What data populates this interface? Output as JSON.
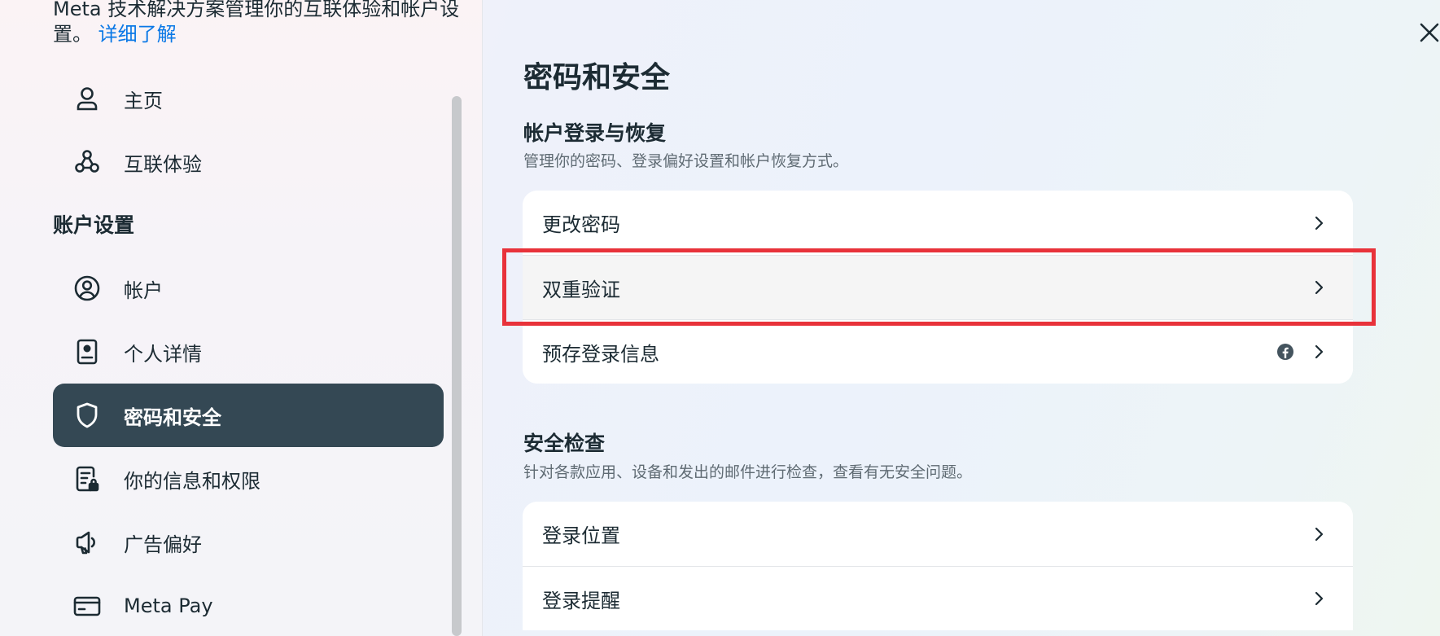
{
  "sidebar": {
    "intro_text": "Meta 技术解决方案管理你的互联体验和帐户设置。",
    "intro_link": "详细了解",
    "items_top": [
      {
        "label": "主页",
        "icon": "person-icon"
      },
      {
        "label": "互联体验",
        "icon": "connected-experiences-icon"
      }
    ],
    "section_title": "账户设置",
    "items": [
      {
        "label": "帐户",
        "icon": "account-circle-icon"
      },
      {
        "label": "个人详情",
        "icon": "id-card-icon"
      },
      {
        "label": "密码和安全",
        "icon": "shield-icon",
        "active": true
      },
      {
        "label": "你的信息和权限",
        "icon": "document-lock-icon"
      },
      {
        "label": "广告偏好",
        "icon": "megaphone-icon"
      },
      {
        "label": "Meta Pay",
        "icon": "credit-card-icon"
      }
    ]
  },
  "main": {
    "title": "密码和安全",
    "groups": [
      {
        "title": "帐户登录与恢复",
        "description": "管理你的密码、登录偏好设置和帐户恢复方式。",
        "rows": [
          {
            "label": "更改密码"
          },
          {
            "label": "双重验证",
            "highlighted": true
          },
          {
            "label": "预存登录信息",
            "badge_icon": "facebook-icon"
          }
        ]
      },
      {
        "title": "安全检查",
        "description": "针对各款应用、设备和发出的邮件进行检查，查看有无安全问题。",
        "rows": [
          {
            "label": "登录位置"
          },
          {
            "label": "登录提醒"
          }
        ]
      }
    ]
  },
  "colors": {
    "active_nav_bg": "#344854",
    "link": "#0a78e6",
    "highlight_border": "#e8323a",
    "text": "#1c2b33"
  }
}
